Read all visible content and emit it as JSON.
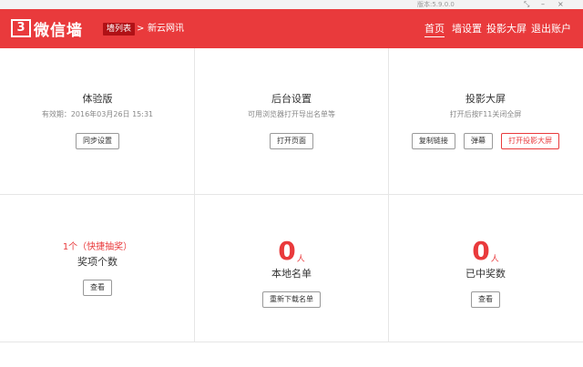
{
  "window": {
    "version": "版本:5.9.0.0",
    "controls": [
      "⤡",
      "–",
      "×"
    ]
  },
  "header": {
    "logo_mark": "3",
    "logo_text": "微信墙",
    "breadcrumb": {
      "tag": "墙列表",
      "sep": ">",
      "current": "新云网讯"
    },
    "nav": [
      "首页",
      "墙设置",
      "投影大屏",
      "退出账户"
    ],
    "accent": "#e93a3c"
  },
  "cells": {
    "trial": {
      "title": "体验版",
      "sub": "有效期：2016年03月26日 15:31",
      "button": "同步设置"
    },
    "backend": {
      "title": "后台设置",
      "sub": "可用浏览器打开导出名单等",
      "button": "打开页面"
    },
    "projector": {
      "title": "投影大屏",
      "sub": "打开后按F11关闭全屏",
      "buttons": [
        "复制链接",
        "弹幕",
        "打开投影大屏"
      ]
    },
    "prizes": {
      "count": "1个（快捷抽奖）",
      "title": "奖项个数",
      "button": "查看"
    },
    "local_list": {
      "num": "0",
      "unit": "人",
      "title": "本地名单",
      "button": "重新下载名单"
    },
    "winners": {
      "num": "0",
      "unit": "人",
      "title": "已中奖数",
      "button": "查看"
    }
  }
}
